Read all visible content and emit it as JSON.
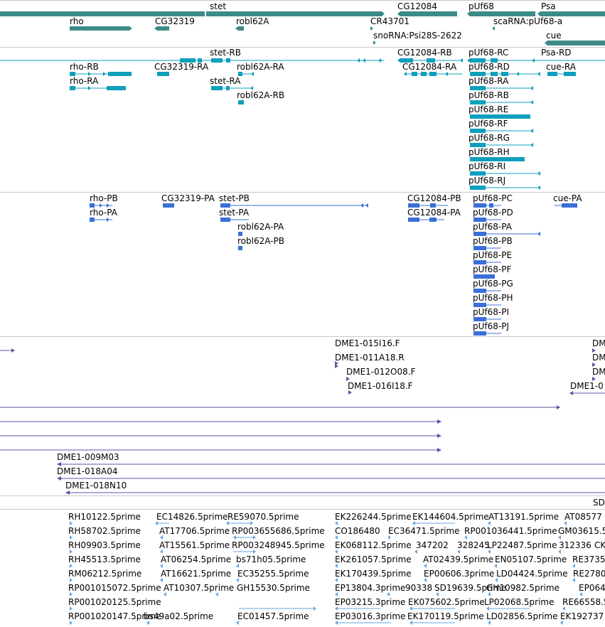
{
  "tracks": {
    "gene_span": {
      "color": "#3d8b87",
      "labels": [
        {
          "text": "stet"
        },
        {
          "text": "CG12084"
        },
        {
          "text": "pUf68"
        },
        {
          "text": "Psa"
        },
        {
          "text": "rho"
        },
        {
          "text": "CG32319"
        },
        {
          "text": "robl62A"
        },
        {
          "text": "CR43701"
        },
        {
          "text": "scaRNA:pUf68-a"
        },
        {
          "text": "snoRNA:Psi28S-2622"
        },
        {
          "text": "cue"
        }
      ]
    },
    "transcripts": {
      "color": "#0e9fbc",
      "labels": [
        {
          "text": "stet-RB"
        },
        {
          "text": "CG12084-RB"
        },
        {
          "text": "pUf68-RC"
        },
        {
          "text": "Psa-RD"
        },
        {
          "text": "rho-RB"
        },
        {
          "text": "CG32319-RA"
        },
        {
          "text": "robl62A-RA"
        },
        {
          "text": "CG12084-RA"
        },
        {
          "text": "pUf68-RD"
        },
        {
          "text": "cue-RA"
        },
        {
          "text": "rho-RA"
        },
        {
          "text": "stet-RA"
        },
        {
          "text": "pUf68-RA"
        },
        {
          "text": "robl62A-RB"
        },
        {
          "text": "pUf68-RB"
        },
        {
          "text": "pUf68-RE"
        },
        {
          "text": "pUf68-RF"
        },
        {
          "text": "pUf68-RG"
        },
        {
          "text": "pUf68-RH"
        },
        {
          "text": "pUf68-RI"
        },
        {
          "text": "pUf68-RJ"
        }
      ]
    },
    "proteins": {
      "color": "#3a6fd8",
      "labels": [
        {
          "text": "rho-PB"
        },
        {
          "text": "CG32319-PA"
        },
        {
          "text": "stet-PB"
        },
        {
          "text": "CG12084-PB"
        },
        {
          "text": "pUf68-PC"
        },
        {
          "text": "cue-PA"
        },
        {
          "text": "rho-PA"
        },
        {
          "text": "stet-PA"
        },
        {
          "text": "CG12084-PA"
        },
        {
          "text": "pUf68-PD"
        },
        {
          "text": "robl62A-PA"
        },
        {
          "text": "pUf68-PA"
        },
        {
          "text": "robl62A-PB"
        },
        {
          "text": "pUf68-PB"
        },
        {
          "text": "pUf68-PE"
        },
        {
          "text": "pUf68-PF"
        },
        {
          "text": "pUf68-PG"
        },
        {
          "text": "pUf68-PH"
        },
        {
          "text": "pUf68-PI"
        },
        {
          "text": "pUf68-PJ"
        }
      ]
    },
    "clones": {
      "color": "#6a4ca8",
      "labels": [
        {
          "text": "DME1-015I16.F"
        },
        {
          "text": "DME1-011A18.R"
        },
        {
          "text": "DME1-012O08.F"
        },
        {
          "text": "DME1-016I18.F"
        },
        {
          "text": "DME1-009M03"
        },
        {
          "text": "DME1-018A04"
        },
        {
          "text": "DME1-018N10"
        },
        {
          "text": "DM"
        },
        {
          "text": "DM"
        },
        {
          "text": "DM"
        },
        {
          "text": "DME1-0"
        }
      ]
    },
    "sd_track": {
      "labels": [
        {
          "text": "SD"
        }
      ]
    },
    "ests": {
      "color": "#6aa6e0",
      "labels": [
        {
          "text": "RH10122.5prime"
        },
        {
          "text": "EC14826.5prime"
        },
        {
          "text": "RE59070.5prime"
        },
        {
          "text": "EK226244.5prime"
        },
        {
          "text": "EK144604.5prime"
        },
        {
          "text": "AT13191.5prime"
        },
        {
          "text": "AT08577"
        },
        {
          "text": "RH58702.5prime"
        },
        {
          "text": "AT17706.5prime"
        },
        {
          "text": "RP003655686.5prime"
        },
        {
          "text": "CO186480"
        },
        {
          "text": "EC36471.5prime"
        },
        {
          "text": "RP001036441.5prime"
        },
        {
          "text": "GM03615.5"
        },
        {
          "text": "RH09903.5prime"
        },
        {
          "text": "AT15561.5prime"
        },
        {
          "text": "RP003248945.5prime"
        },
        {
          "text": "EK068112.5prime"
        },
        {
          "text": "347202"
        },
        {
          "text": "328245"
        },
        {
          "text": "LP22487.5prime"
        },
        {
          "text": "312336"
        },
        {
          "text": "CK"
        },
        {
          "text": "RH45513.5prime"
        },
        {
          "text": "AT06254.5prime"
        },
        {
          "text": "bs71h05.5prime"
        },
        {
          "text": "EK261057.5prime"
        },
        {
          "text": "AT02439.5prime"
        },
        {
          "text": "EN05107.5prime"
        },
        {
          "text": "RE3735"
        },
        {
          "text": "RM06212.5prime"
        },
        {
          "text": "AT16621.5prime"
        },
        {
          "text": "EC35255.5prime"
        },
        {
          "text": "EK170439.5prime"
        },
        {
          "text": "EP00606.3prime"
        },
        {
          "text": "LD04424.5prime"
        },
        {
          "text": "RE2780"
        },
        {
          "text": "RP001015072.5prime"
        },
        {
          "text": "AT10307.5prime"
        },
        {
          "text": "GH15530.5prime"
        },
        {
          "text": "EP13804.3prime"
        },
        {
          "text": "90338"
        },
        {
          "text": "SD19639.5prime"
        },
        {
          "text": "GH10982.5prime"
        },
        {
          "text": "EP064"
        },
        {
          "text": "RP001020125.5prime"
        },
        {
          "text": "EP03215.3prime"
        },
        {
          "text": "EK075602.5prime"
        },
        {
          "text": "LP02068.5prime"
        },
        {
          "text": "RE66558.5p"
        },
        {
          "text": "RP001020147.5prime"
        },
        {
          "text": "bs49a02.5prime"
        },
        {
          "text": "EC01457.5prime"
        },
        {
          "text": "EP03016.3prime"
        },
        {
          "text": "EK170119.5prime"
        },
        {
          "text": "LD02856.5prime"
        },
        {
          "text": "EK192737"
        }
      ]
    }
  }
}
